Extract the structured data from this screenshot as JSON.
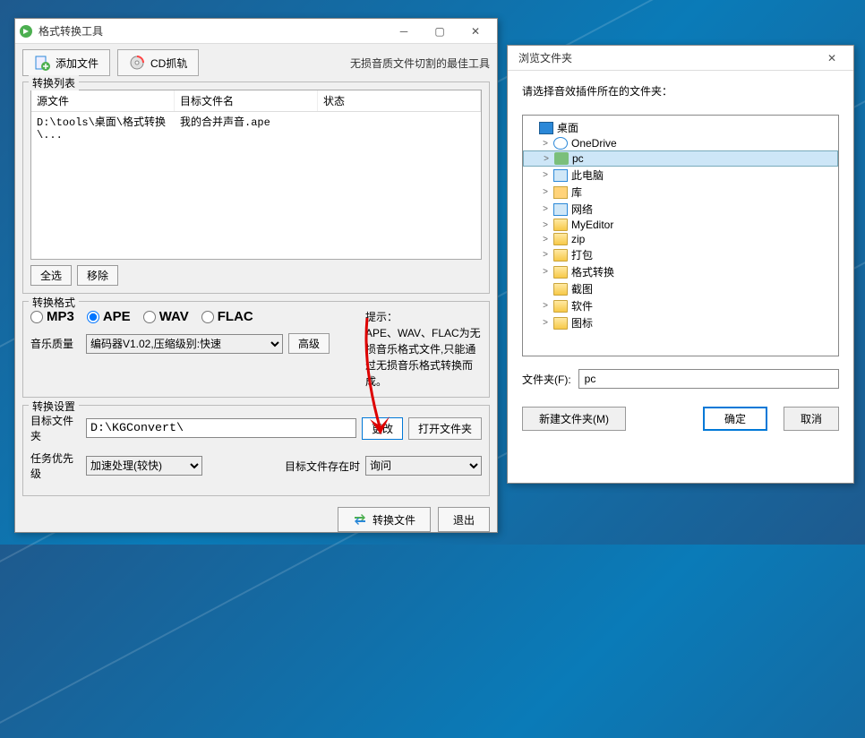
{
  "main": {
    "title": "格式转换工具",
    "toolbar": {
      "add_file": "添加文件",
      "cd_rip": "CD抓轨"
    },
    "slogan": "无损音质文件切割的最佳工具",
    "convert_group": "转换列表",
    "columns": {
      "src": "源文件",
      "target": "目标文件名",
      "status": "状态"
    },
    "rows": [
      {
        "src": "D:\\tools\\桌面\\格式转换\\...",
        "target": "我的合并声音.ape",
        "status": ""
      }
    ],
    "select_all": "全选",
    "remove": "移除",
    "format_group": "转换格式",
    "formats": [
      "MP3",
      "APE",
      "WAV",
      "FLAC"
    ],
    "selected_format": "APE",
    "quality_label": "音乐质量",
    "quality_value": "编码器V1.02,压缩级别:快速",
    "advanced": "高级",
    "hint_title": "提示：",
    "hint_body": "APE、WAV、FLAC为无损音乐格式文件,只能通过无损音乐格式转换而成。",
    "settings_group": "转换设置",
    "target_label": "目标文件夹",
    "target_path": "D:\\KGConvert\\",
    "change": "更改",
    "open_folder": "打开文件夹",
    "priority_label": "任务优先级",
    "priority_value": "加速处理(较快)",
    "exists_label": "目标文件存在时",
    "exists_value": "询问",
    "convert": "转换文件",
    "exit": "退出"
  },
  "browse": {
    "title": "浏览文件夹",
    "prompt": "请选择音效插件所在的文件夹：",
    "tree": [
      {
        "indent": 0,
        "chev": "",
        "icon": "desktop",
        "label": "桌面"
      },
      {
        "indent": 1,
        "chev": ">",
        "icon": "cloud",
        "label": "OneDrive"
      },
      {
        "indent": 1,
        "chev": ">",
        "icon": "user",
        "label": "pc",
        "selected": true
      },
      {
        "indent": 1,
        "chev": ">",
        "icon": "pc",
        "label": "此电脑"
      },
      {
        "indent": 1,
        "chev": ">",
        "icon": "lib",
        "label": "库"
      },
      {
        "indent": 1,
        "chev": ">",
        "icon": "net",
        "label": "网络"
      },
      {
        "indent": 1,
        "chev": ">",
        "icon": "folder",
        "label": "MyEditor"
      },
      {
        "indent": 1,
        "chev": ">",
        "icon": "folder",
        "label": "zip"
      },
      {
        "indent": 1,
        "chev": ">",
        "icon": "folder",
        "label": "打包"
      },
      {
        "indent": 1,
        "chev": ">",
        "icon": "folder",
        "label": "格式转换"
      },
      {
        "indent": 1,
        "chev": "",
        "icon": "folder",
        "label": "截图"
      },
      {
        "indent": 1,
        "chev": ">",
        "icon": "folder",
        "label": "软件"
      },
      {
        "indent": 1,
        "chev": ">",
        "icon": "folder",
        "label": "图标"
      }
    ],
    "folder_label": "文件夹(F):",
    "folder_value": "pc",
    "new_folder": "新建文件夹(M)",
    "ok": "确定",
    "cancel": "取消"
  }
}
